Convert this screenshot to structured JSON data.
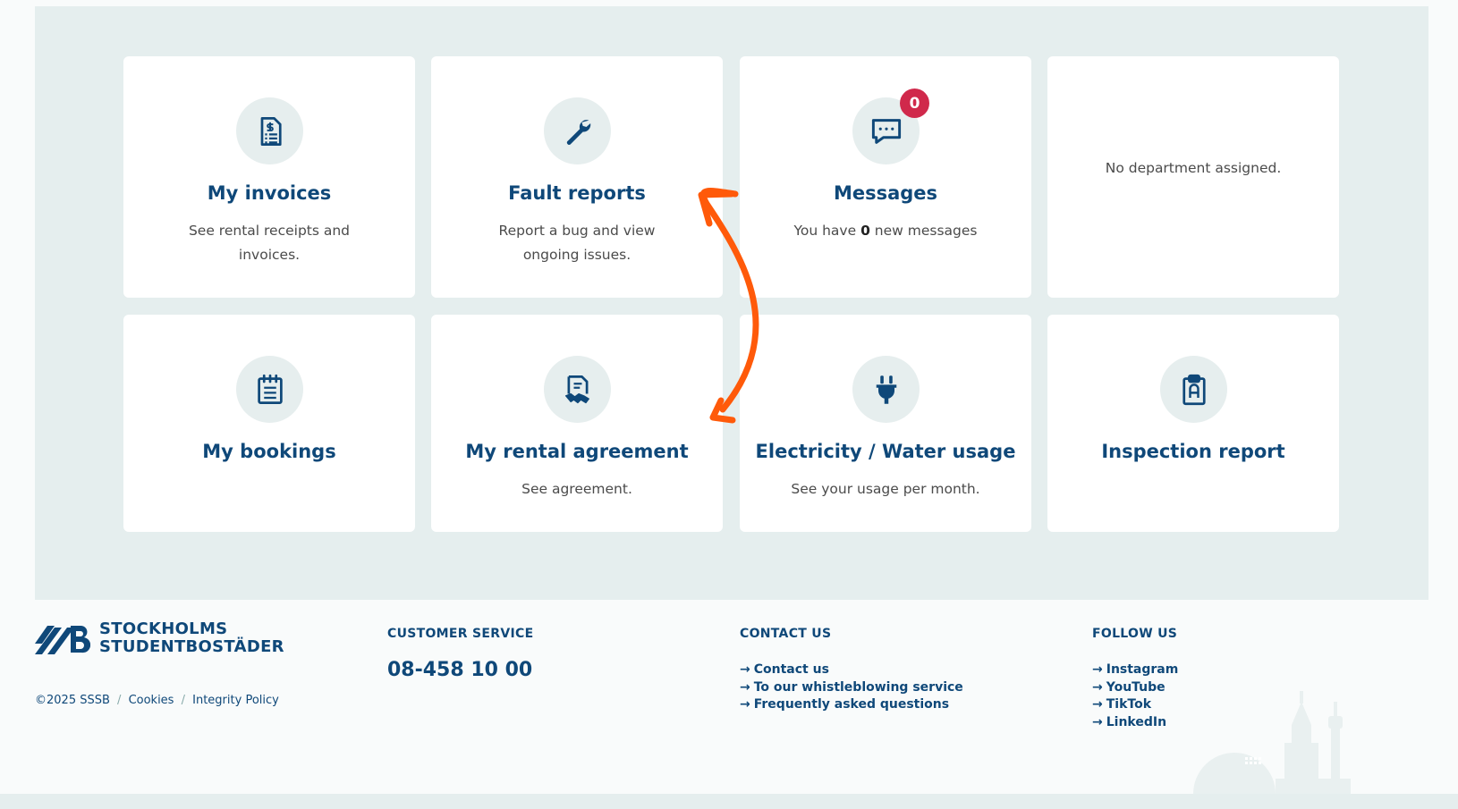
{
  "cards": {
    "invoices": {
      "title": "My invoices",
      "desc": "See rental receipts and invoices."
    },
    "fault": {
      "title": "Fault reports",
      "desc": "Report a bug and view ongoing issues."
    },
    "messages": {
      "title": "Messages",
      "desc_pre": "You have ",
      "count": "0",
      "desc_post": " new messages",
      "badge": "0"
    },
    "department": {
      "text": "No department assigned."
    },
    "bookings": {
      "title": "My bookings"
    },
    "rental": {
      "title": "My rental agreement",
      "desc": "See agreement."
    },
    "electricity": {
      "title": "Electricity / Water usage",
      "desc": "See your usage per month."
    },
    "inspection": {
      "title": "Inspection report"
    }
  },
  "footer": {
    "logo_line1": "STOCKHOLMS",
    "logo_line2": "STUDENTBOSTÄDER",
    "copyright": "©2025 SSSB",
    "cookies": "Cookies",
    "integrity": "Integrity Policy",
    "separator": "/",
    "customer_service": {
      "heading": "CUSTOMER SERVICE",
      "phone": "08-458 10 00"
    },
    "contact": {
      "heading": "CONTACT US",
      "links": [
        "Contact us",
        "To our whistleblowing service",
        "Frequently asked questions"
      ]
    },
    "follow": {
      "heading": "FOLLOW US",
      "links": [
        "Instagram",
        "YouTube",
        "TikTok",
        "LinkedIn"
      ]
    },
    "arrow_glyph": "→"
  },
  "colors": {
    "brand": "#0f4879",
    "panel": "#e5eeee",
    "badge": "#d0294b",
    "annotation": "#ff5a0a"
  },
  "icons": [
    "invoice-icon",
    "wrench-icon",
    "chat-icon",
    "calendar-icon",
    "contract-icon",
    "plug-icon",
    "clipboard-icon",
    "arrow-right-icon"
  ]
}
